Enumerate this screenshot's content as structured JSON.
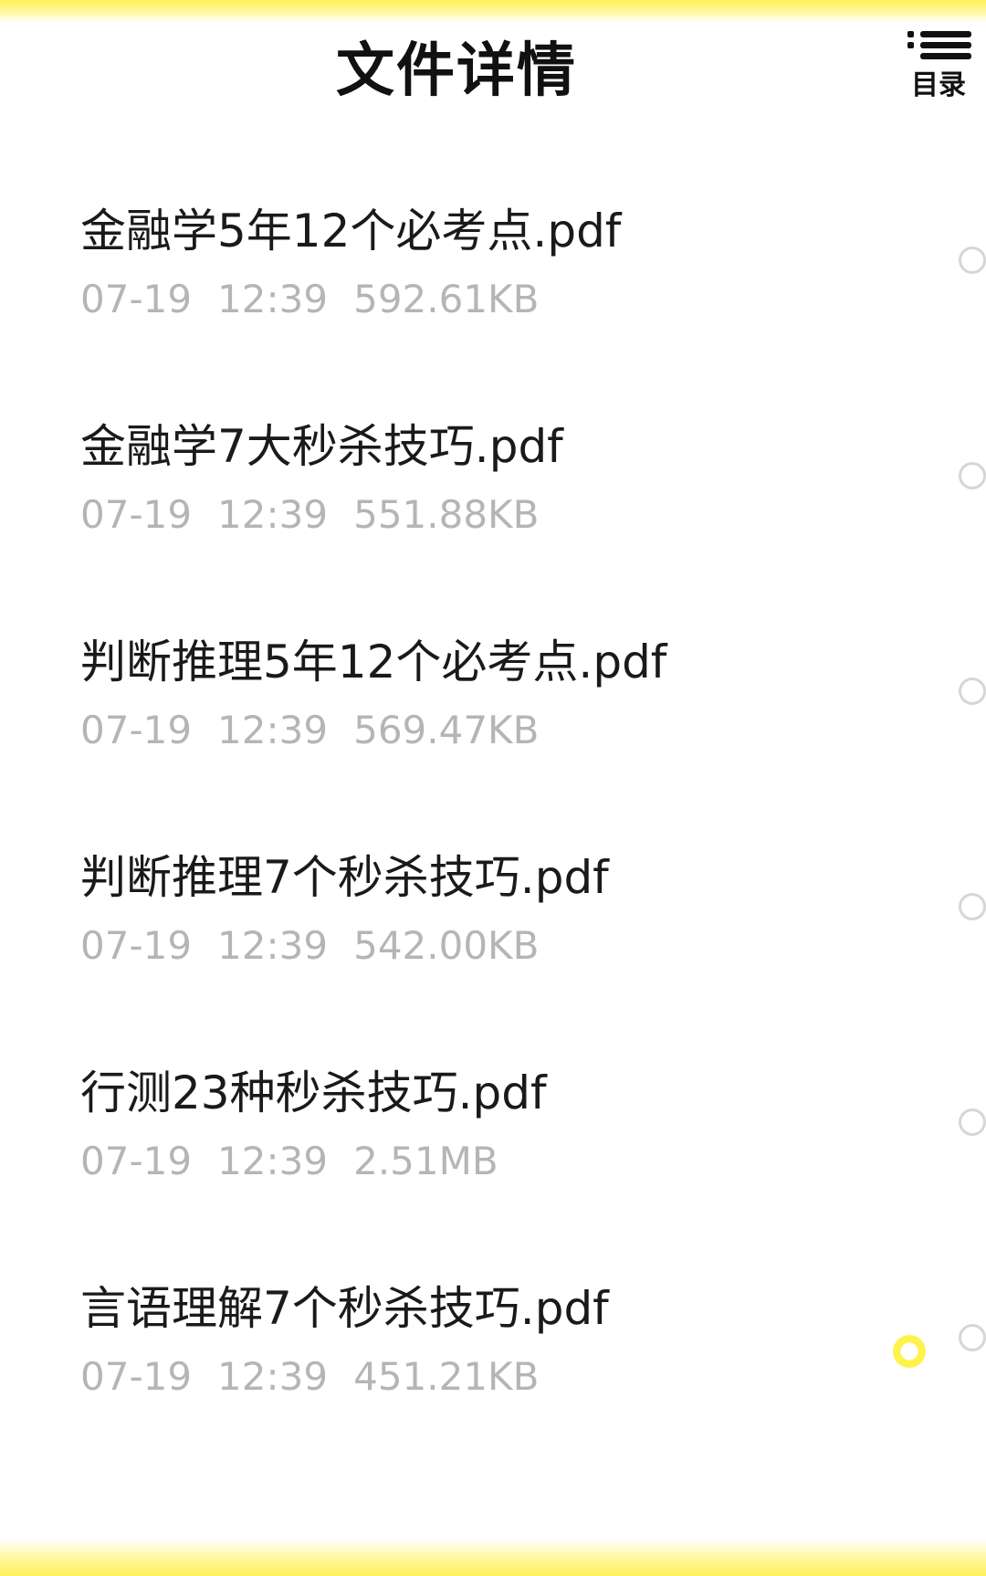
{
  "header": {
    "title": "文件详情",
    "toc_label": "目录",
    "toc_icon": "list-icon"
  },
  "files": [
    {
      "name": "金融学5年12个必考点.pdf",
      "date": "07-19",
      "time": "12:39",
      "size": "592.61KB"
    },
    {
      "name": "金融学7大秒杀技巧.pdf",
      "date": "07-19",
      "time": "12:39",
      "size": "551.88KB"
    },
    {
      "name": "判断推理5年12个必考点.pdf",
      "date": "07-19",
      "time": "12:39",
      "size": "569.47KB"
    },
    {
      "name": "判断推理7个秒杀技巧.pdf",
      "date": "07-19",
      "time": "12:39",
      "size": "542.00KB"
    },
    {
      "name": "行测23种秒杀技巧.pdf",
      "date": "07-19",
      "time": "12:39",
      "size": "2.51MB"
    },
    {
      "name": "言语理解7个秒杀技巧.pdf",
      "date": "07-19",
      "time": "12:39",
      "size": "451.21KB"
    }
  ],
  "colors": {
    "highlight": "#fff25a",
    "meta_text": "#b5b5b5",
    "radio_border": "#d6d6d6"
  }
}
